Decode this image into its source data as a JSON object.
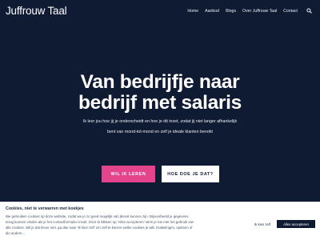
{
  "brand": "Juffrouw Taal",
  "nav": {
    "items": [
      "Home",
      "Aanbod",
      "Blogs",
      "Over Juffrouw Taal",
      "Contact"
    ]
  },
  "icons": {
    "search": "search-icon"
  },
  "hero": {
    "title_line1": "Van bedrijfje naar",
    "title_line2": "bedrijf met salaris",
    "text_line1": "Ik leer jou hoe jij je onderscheidt en hoe je dit inzet, zodat jij niet langer afhankelijk",
    "text_line2": "bent van mond-tot-mond en zelf je ideale klanten bereikt",
    "primary_button": "WIL IK LEREN",
    "secondary_button": "HOE DOE JE DAT?"
  },
  "cookie": {
    "title": "Cookies, niet te verwarren met koekjes",
    "line1": "We gebruiken cookies op deze website, zodat we je zo goed mogelijk van dienst kunnen zijn. Bijvoorbeeld je gegevens",
    "line2": "terug kunnen vinden als je het contactformulier invult. Door te klikken op 'Alles accepteren' stem je toe met het gebruik van",
    "line3": "alle cookies. Wil je dat liever niet, ga dan naar 'Ik kies zelf' om zelf te kiezen welke cookies je wilt. Krakelingen, spritsen of",
    "line4": "dio andere...",
    "own_choice": "Ik kies zelf",
    "accept_all": "Alles accepteren"
  },
  "colors": {
    "background": "#0f1a33",
    "accent": "#e4448c",
    "text": "#ffffff"
  }
}
